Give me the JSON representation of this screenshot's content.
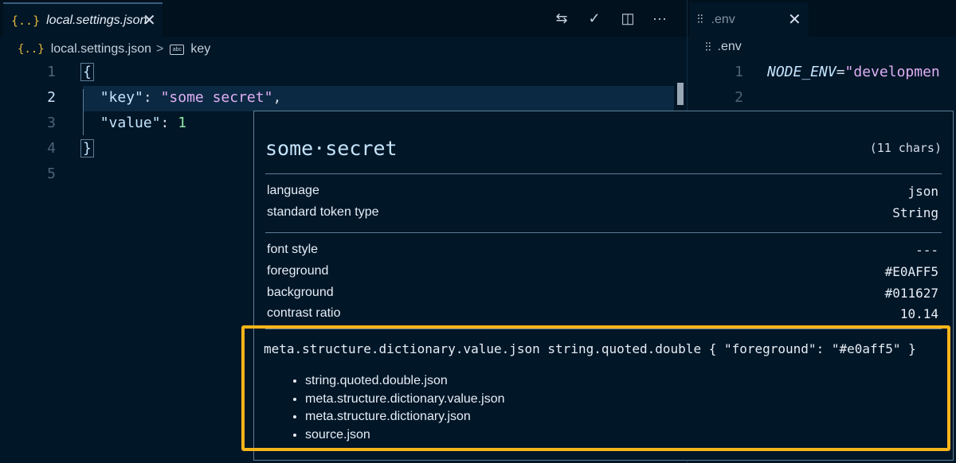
{
  "left_editor": {
    "tab": {
      "icon": "{..}",
      "label": "local.settings.json",
      "close": "✕"
    },
    "toolbar": [
      {
        "name": "open-changes-icon",
        "glyph": "⇆"
      },
      {
        "name": "check-icon",
        "glyph": "✓"
      },
      {
        "name": "split-editor-icon",
        "glyph": "◫"
      },
      {
        "name": "more-actions-icon",
        "glyph": "···"
      }
    ],
    "breadcrumb": {
      "file": "local.settings.json",
      "separator": ">",
      "symbol": "key",
      "symbol_icon_text": "abc"
    },
    "line_numbers": [
      "1",
      "2",
      "3",
      "4",
      "5"
    ],
    "code": {
      "l1": "{",
      "l2_key": "\"key\"",
      "l2_colon": ": ",
      "l2_value": "\"some secret\"",
      "l2_comma": ",",
      "l3_key": "\"value\"",
      "l3_colon": ": ",
      "l3_value": "1",
      "l4": "}"
    }
  },
  "right_editor": {
    "tab": {
      "label": ".env",
      "close": "✕"
    },
    "breadcrumb": ".env",
    "line_numbers": [
      "1",
      "2"
    ],
    "code": {
      "l1_var": "NODE_ENV",
      "l1_eq": "=",
      "l1_value": "\"developmen"
    }
  },
  "hover": {
    "token": "some·secret",
    "chars": "(11 chars)",
    "rows_a": [
      {
        "label": "language",
        "value": "json"
      },
      {
        "label": "standard token type",
        "value": "String"
      }
    ],
    "rows_b": [
      {
        "label": "font style",
        "value": "---"
      },
      {
        "label": "foreground",
        "value": "#E0AFF5"
      },
      {
        "label": "background",
        "value": "#011627"
      },
      {
        "label": "contrast ratio",
        "value": "10.14"
      }
    ],
    "scope_rule": "meta.structure.dictionary.value.json string.quoted.double { \"foreground\": \"#e0aff5\" }",
    "scopes": [
      "string.quoted.double.json",
      "meta.structure.dictionary.value.json",
      "meta.structure.dictionary.json",
      "source.json"
    ]
  },
  "colors": {
    "background": "#011627",
    "string": "#e0aff5",
    "highlight_box": "#f7b51a",
    "json_icon": "#e2b93d"
  }
}
